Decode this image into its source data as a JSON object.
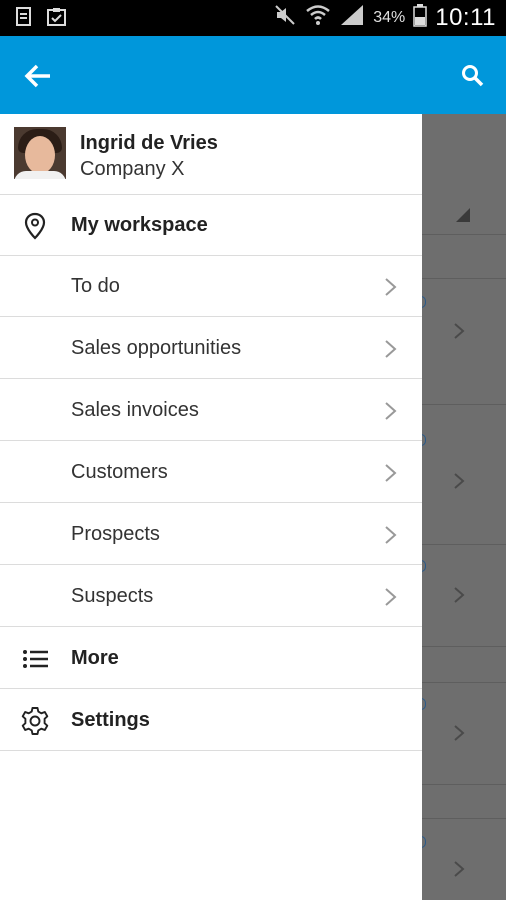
{
  "status_bar": {
    "battery_percent": "34%",
    "time": "10:11",
    "icons": [
      "document-icon",
      "clipboard-icon",
      "mute-icon",
      "wifi-icon",
      "signal-icon",
      "battery-icon"
    ]
  },
  "app_bar": {
    "color": "#0097db",
    "back_icon": "arrow-left-icon",
    "search_icon": "search-icon"
  },
  "profile": {
    "name": "Ingrid de Vries",
    "company": "Company X"
  },
  "menu": {
    "workspace": {
      "label": "My workspace",
      "icon": "location-pin-icon"
    },
    "items": [
      {
        "label": "To do"
      },
      {
        "label": "Sales opportunities"
      },
      {
        "label": "Sales invoices"
      },
      {
        "label": "Customers"
      },
      {
        "label": "Prospects"
      },
      {
        "label": "Suspects"
      }
    ],
    "more": {
      "label": "More",
      "icon": "list-icon"
    },
    "settings": {
      "label": "Settings",
      "icon": "gear-icon"
    }
  }
}
